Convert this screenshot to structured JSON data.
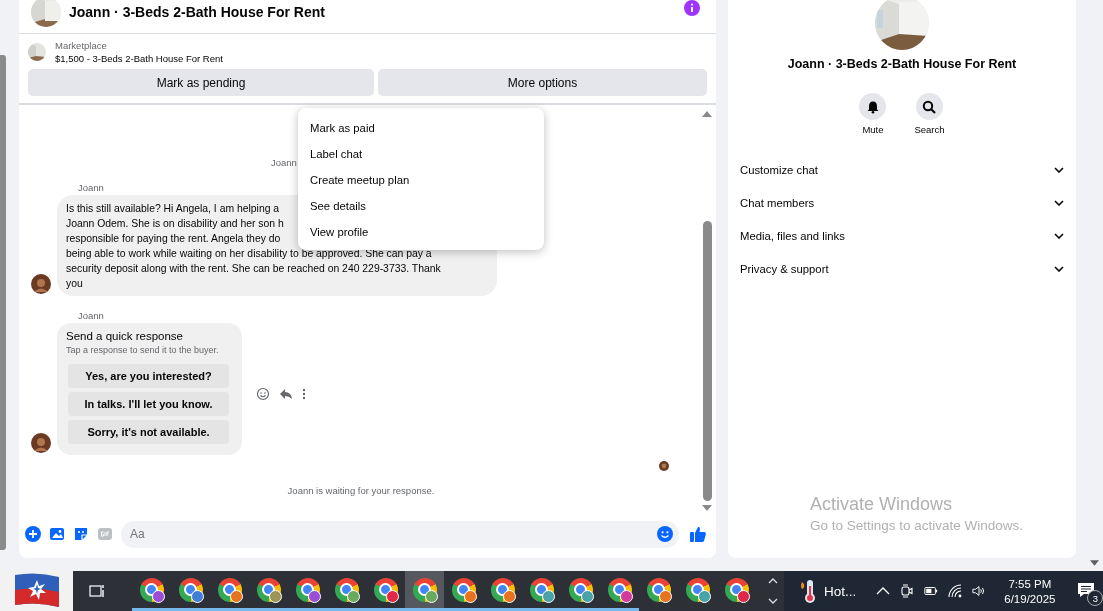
{
  "chat": {
    "title": "Joann · 3-Beds 2-Bath House For Rent",
    "listing": {
      "source": "Marketplace",
      "title": "$1,500 - 3-Beds 2-Bath House For Rent"
    },
    "actions": [
      "Mark as pending",
      "More options"
    ],
    "menu": [
      "Mark as paid",
      "Label chat",
      "Create meetup plan",
      "See details",
      "View profile"
    ],
    "timestamp": "Joann",
    "messages": [
      {
        "kind": "text",
        "sender": "Joann",
        "lines": [
          "Is this still available? Hi Angela, I am helping a",
          "Joann Odem. She is on disability and her son h",
          "responsible for paying the rent.  Angela they do",
          "being able to work while waiting on her disability to be approved.  She can pay a",
          "security deposit along with the rent.  She can be reached on 240 229-3733.  Thank",
          "you"
        ]
      },
      {
        "kind": "quick_response",
        "sender": "Joann",
        "title": "Send a quick response",
        "hint": "Tap a response to send it to the buyer.",
        "responses": [
          "Yes, are you interested?",
          "In talks. I'll let you know.",
          "Sorry, it's not available."
        ]
      }
    ],
    "status": "Joann is waiting for your response.",
    "composer": {
      "placeholder": "Aa"
    }
  },
  "details": {
    "title": "Joann · 3-Beds 2-Bath House For Rent",
    "actions": [
      {
        "kind": "mute",
        "label": "Mute"
      },
      {
        "kind": "search",
        "label": "Search"
      }
    ],
    "sections": [
      {
        "label": "Customize chat",
        "expanded": false
      },
      {
        "label": "Chat members",
        "expanded": false
      },
      {
        "label": "Media, files and links",
        "expanded": false
      },
      {
        "label": "Privacy & support",
        "expanded": false
      }
    ]
  },
  "activation_notice": {
    "title": "Activate Windows",
    "text": "Go to Settings to activate Windows."
  },
  "taskbar": {
    "apps": [
      {
        "color": "#9b4fd6",
        "running": true,
        "selected": false
      },
      {
        "color": "#3f7fd8",
        "running": true,
        "selected": false
      },
      {
        "color": "#e8731f",
        "running": true,
        "selected": false
      },
      {
        "color": "#9c9456",
        "running": true,
        "selected": false
      },
      {
        "color": "#9b4fd6",
        "running": true,
        "selected": false
      },
      {
        "color": "#6aaa5c",
        "running": true,
        "selected": false
      },
      {
        "color": "#e02848",
        "running": true,
        "selected": false
      },
      {
        "color": "#6aaa5c",
        "running": true,
        "selected": true
      },
      {
        "color": "#e8731f",
        "running": true,
        "selected": false
      },
      {
        "color": "#e8731f",
        "running": true,
        "selected": false
      },
      {
        "color": "#4aa3a8",
        "running": true,
        "selected": false
      },
      {
        "color": "#4aa3a8",
        "running": true,
        "selected": false
      },
      {
        "color": "#d43a9a",
        "running": true,
        "selected": false
      },
      {
        "color": "#e8731f",
        "running": false,
        "selected": false
      },
      {
        "color": "#4aa3a8",
        "running": false,
        "selected": false
      },
      {
        "color": "#e02848",
        "running": false,
        "selected": false
      }
    ],
    "weather": "Hot...",
    "time": "7:55 PM",
    "date": "6/19/2025",
    "notifications": "3"
  }
}
